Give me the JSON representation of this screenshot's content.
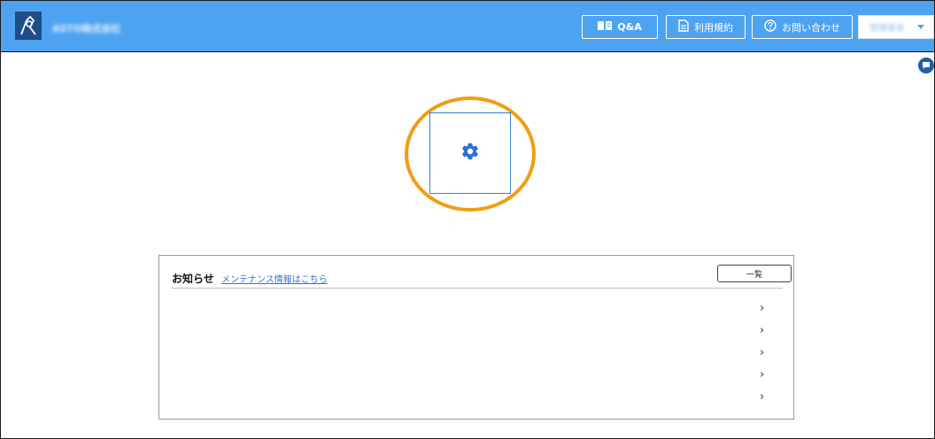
{
  "header": {
    "company_name": "ASTO株式会社",
    "buttons": {
      "qa": "Q&A",
      "terms": "利用規約",
      "contact": "お問い合わせ"
    },
    "user_menu": "管理者名"
  },
  "notice": {
    "title": "お知らせ",
    "maintenance_link": "メンテナンス情報はこちら",
    "list_button": "一覧",
    "items": [
      {
        "chevron": "›"
      },
      {
        "chevron": "›"
      },
      {
        "chevron": "›"
      },
      {
        "chevron": "›"
      },
      {
        "chevron": "›"
      }
    ]
  },
  "colors": {
    "header": "#4ea3f1",
    "accent": "#3d7fd6",
    "highlight": "#f29c12"
  },
  "icons": [
    "logo-icon",
    "book-icon",
    "document-icon",
    "help-icon",
    "chat-icon",
    "gear-icon"
  ]
}
